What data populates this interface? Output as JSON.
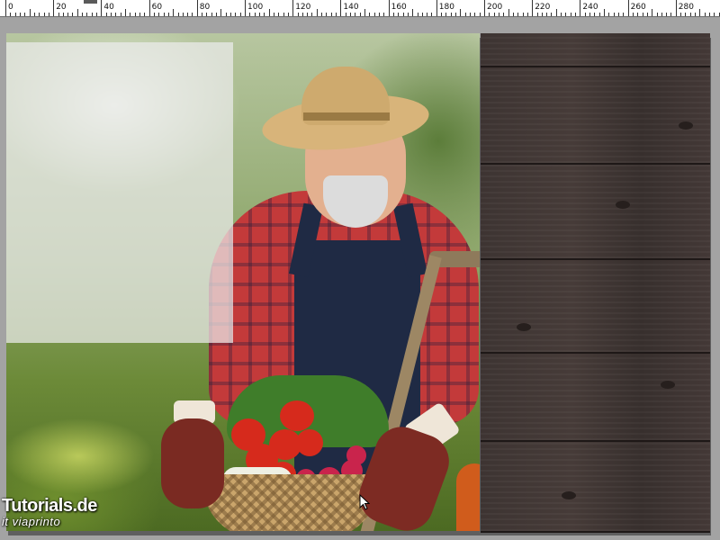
{
  "ruler": {
    "labels": [
      "0",
      "20",
      "40",
      "60",
      "80",
      "100",
      "120",
      "140",
      "160",
      "180",
      "200",
      "220",
      "240",
      "260",
      "280"
    ]
  },
  "photo": {
    "subject": "gardener"
  },
  "watermark": {
    "title": "Tutorials.de",
    "subtitle": "it viaprinto"
  },
  "icons": {
    "cursor": "arrow-cursor-icon"
  },
  "colors": {
    "pasteboard": "#a3a3a3",
    "wood": "#3a3230",
    "overlay": "#ececec"
  }
}
